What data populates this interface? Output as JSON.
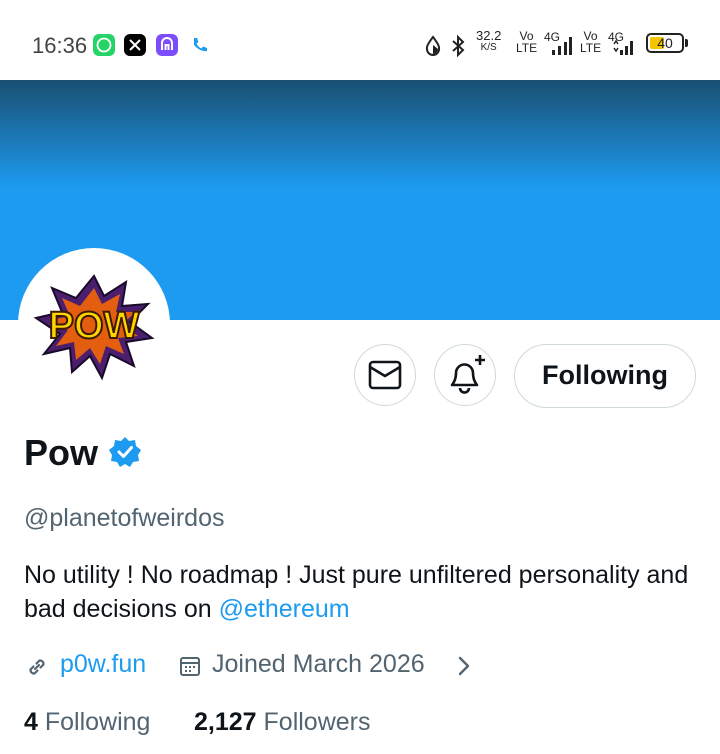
{
  "status_bar": {
    "time": "16:36",
    "speed_value": "32.2",
    "speed_unit": "K/S",
    "vo1": "Vo",
    "lte1": "LTE",
    "net1": "4G",
    "vo2": "Vo",
    "lte2": "LTE",
    "net2": "4G",
    "battery": "40",
    "notification_icons": [
      "whatsapp-icon",
      "x-app-icon",
      "purple-app-icon",
      "phone-icon"
    ]
  },
  "profile": {
    "follow_button_label": "Following",
    "name": "Pow",
    "handle": "@planetofweirdos",
    "bio_text": "No utility ! No roadmap ! Just pure unfiltered personality and bad decisions on ",
    "bio_mention": "@ethereum",
    "website": "p0w.fun",
    "joined": "Joined March 2026",
    "following_count": "4",
    "following_label": "Following",
    "followers_count": "2,127",
    "followers_label": "Followers",
    "avatar_text": "POW"
  },
  "colors": {
    "accent": "#1d9bf0",
    "secondary_text": "#536471",
    "border": "#cfd9de"
  }
}
